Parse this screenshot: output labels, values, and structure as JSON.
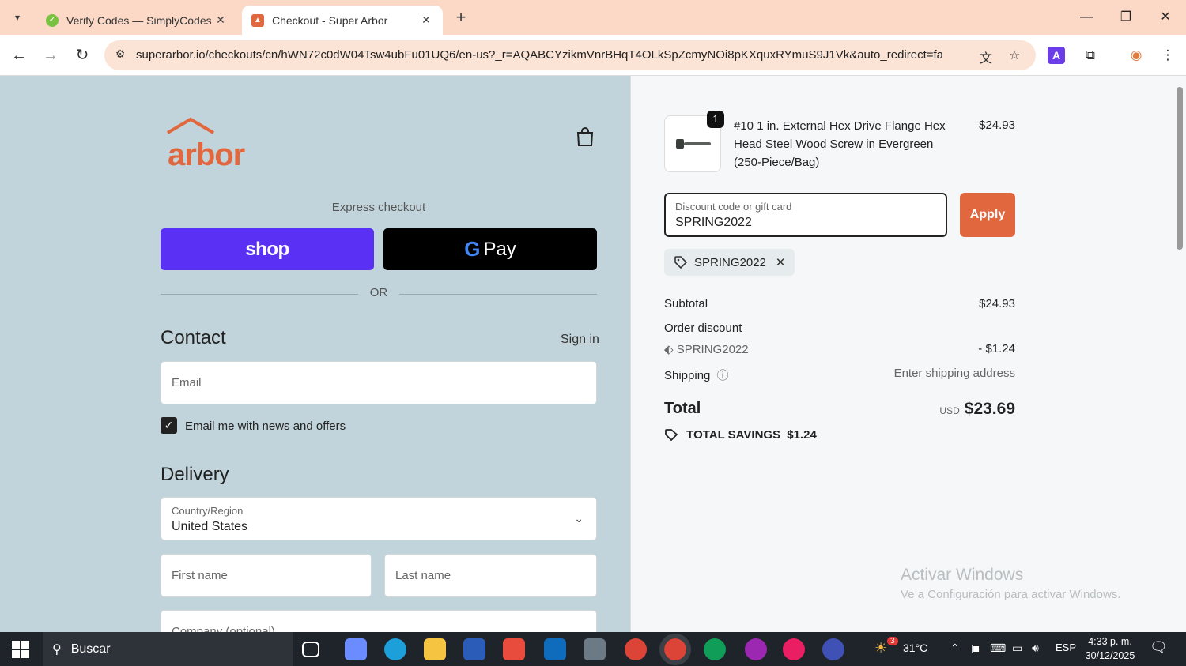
{
  "browser": {
    "tabs": [
      {
        "title": "Verify Codes — SimplyCodes",
        "active": false
      },
      {
        "title": "Checkout - Super Arbor",
        "active": true
      }
    ],
    "url": "superarbor.io/checkouts/cn/hWN72c0dW04Tsw4ubFu01UQ6/en-us?_r=AQABCYzikmVnrBHqT4OLkSpZcmyNOi8pKXquxRYmuS9J1Vk&auto_redirect=false..."
  },
  "store": {
    "logo_text": "arbor",
    "brand_color": "#e0673e"
  },
  "checkout": {
    "express_label": "Express checkout",
    "shop_label": "shop",
    "gpay_g": "G",
    "gpay_label": "Pay",
    "or_label": "OR",
    "contact_title": "Contact",
    "signin_label": "Sign in",
    "email_placeholder": "Email",
    "news_label": "Email me with news and offers",
    "news_checked": true,
    "delivery_title": "Delivery",
    "country_label": "Country/Region",
    "country_value": "United States",
    "first_name_placeholder": "First name",
    "last_name_placeholder": "Last name",
    "company_placeholder": "Company (optional)"
  },
  "summary": {
    "item": {
      "qty": "1",
      "name": "#10 1 in. External Hex Drive Flange Hex Head Steel Wood Screw in Evergreen (250-Piece/Bag)",
      "price": "$24.93"
    },
    "discount_label": "Discount code or gift card",
    "discount_value": "SPRING2022",
    "apply_label": "Apply",
    "applied_code": "SPRING2022",
    "subtotal_label": "Subtotal",
    "subtotal_value": "$24.93",
    "order_discount_label": "Order discount",
    "order_discount_code": "SPRING2022",
    "order_discount_value": "- $1.24",
    "shipping_label": "Shipping",
    "shipping_value": "Enter shipping address",
    "total_label": "Total",
    "currency": "USD",
    "total_value": "$23.69",
    "savings_label": "TOTAL SAVINGS",
    "savings_value": "$1.24"
  },
  "watermark": {
    "line1": "Activar Windows",
    "line2": "Ve a Configuración para activar Windows."
  },
  "taskbar": {
    "search_label": "Buscar",
    "weather_temp": "31°C",
    "weather_badge": "3",
    "language": "ESP",
    "time": "4:33 p. m.",
    "date": "30/12/2025"
  }
}
